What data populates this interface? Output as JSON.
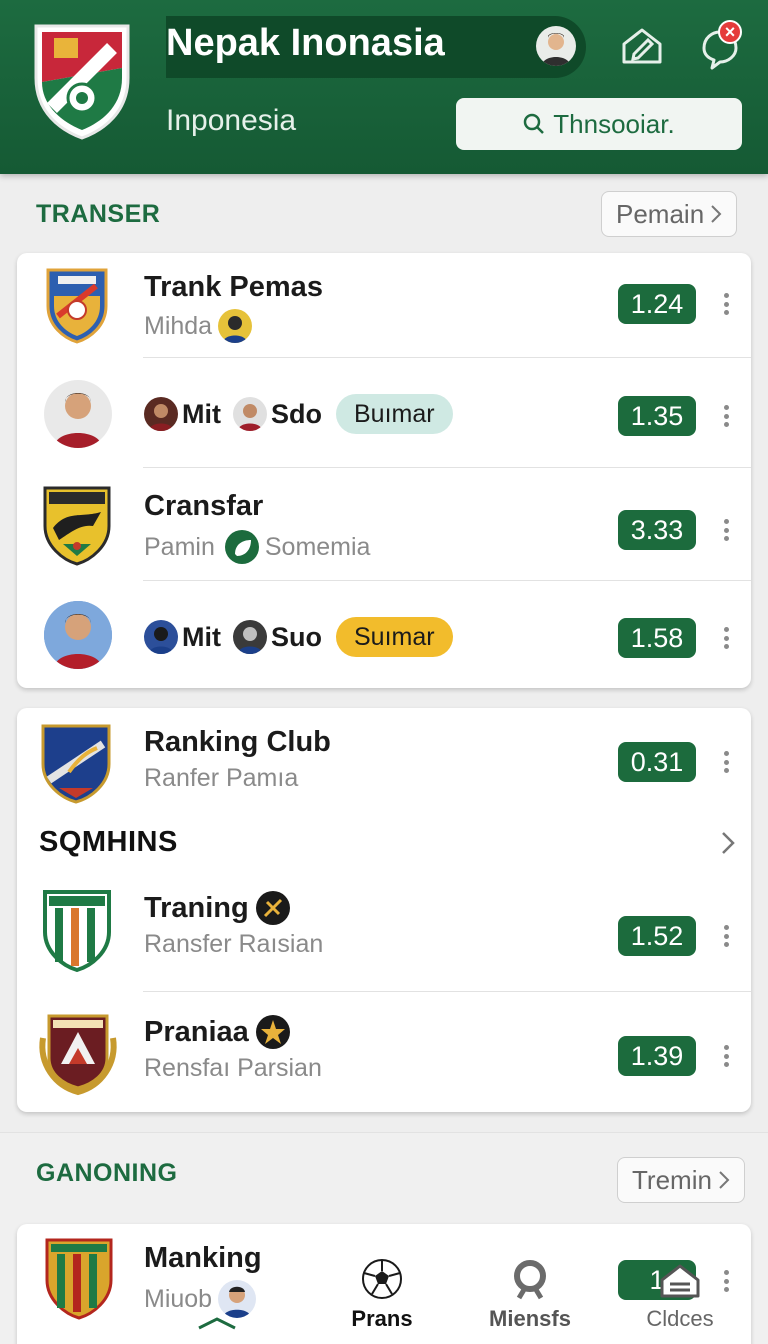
{
  "header": {
    "title": "Nepak Inonasia",
    "subtitle": "Inponesia",
    "search_label": "Thnsooiar.",
    "notification_badge": "×"
  },
  "sections": {
    "transfer": {
      "title": "TRANSER",
      "action_label": "Pemain"
    },
    "squad": {
      "title": "SQMHINS"
    },
    "ganoning": {
      "title": "GANONING",
      "action_label": "Tremin"
    }
  },
  "transfer_rows": [
    {
      "title": "Trank Pemas",
      "sub": "Mihda",
      "odds": "1.24"
    },
    {
      "name_a": "Mit",
      "name_b": "Sdo",
      "tag": "Buımar",
      "tag_color": "#cfe9e3",
      "odds": "1.35"
    },
    {
      "title": "Cransfar",
      "sub_a": "Pamin",
      "sub_b": "Somemia",
      "odds": "3.33"
    },
    {
      "name_a": "Mit",
      "name_b": "Suo",
      "tag": "Suımar",
      "tag_color": "#f2bc2c",
      "odds": "1.58"
    }
  ],
  "club_rows": [
    {
      "title": "Ranking Club",
      "sub": "Ranfer Pamıa",
      "odds": "0.31"
    },
    {
      "title": "Traning",
      "sub": "Ransfer Raısian",
      "odds": "1.52"
    },
    {
      "title": "Praniaa",
      "sub": "Rensfaı Parsian",
      "odds": "1.39"
    }
  ],
  "bottom_row": {
    "title": "Manking",
    "sub": "Miuob",
    "odds": "1"
  },
  "nav": {
    "items": [
      {
        "label": "Prans",
        "icon": "soccer-ball-icon"
      },
      {
        "label": "Miensfs",
        "icon": "search-icon"
      },
      {
        "label": "Cldces",
        "icon": "home-icon"
      }
    ]
  },
  "colors": {
    "brand_green": "#1d6b40",
    "odds_green": "#1c6b3d",
    "header_dark": "#0f4a29"
  }
}
